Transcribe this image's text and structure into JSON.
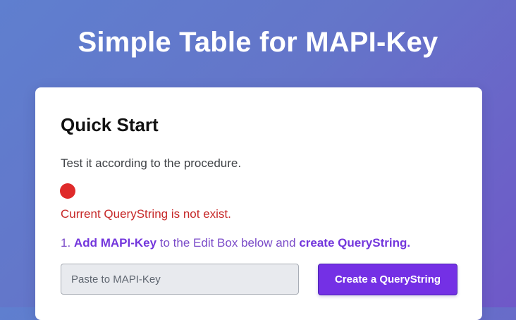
{
  "page": {
    "title": "Simple Table for MAPI-Key"
  },
  "quick_start": {
    "title": "Quick Start",
    "instruction": "Test it according to the procedure.",
    "status": {
      "indicator_color": "#df2a2a",
      "message": "Current QueryString is not exist."
    },
    "step_1": {
      "number": "1.",
      "action_1": "Add MAPI-Key",
      "middle_text": "to the Edit Box below and",
      "action_2": "create QueryString."
    },
    "mapi_key_input": {
      "value": "",
      "placeholder": "Paste to MAPI-Key"
    },
    "create_button": {
      "label": "Create a QueryString"
    }
  },
  "colors": {
    "background_start": "#5f7fcf",
    "background_end": "#6f58c8",
    "accent": "#7430e5",
    "error": "#c62828"
  }
}
